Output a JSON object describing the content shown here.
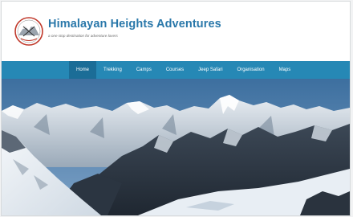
{
  "site": {
    "title": "Himalayan Heights Adventures",
    "tagline": "a one stop destination for adventure lovers"
  },
  "nav": {
    "items": [
      {
        "label": "Home",
        "active": true
      },
      {
        "label": "Trekking",
        "active": false
      },
      {
        "label": "Camps",
        "active": false
      },
      {
        "label": "Courses",
        "active": false
      },
      {
        "label": "Jeep Safari",
        "active": false
      },
      {
        "label": "Organisation",
        "active": false
      },
      {
        "label": "Maps",
        "active": false
      }
    ]
  },
  "icons": {
    "logo": "mountain-compass-logo-icon"
  },
  "colors": {
    "brand": "#2a78aa",
    "navbar": "#2688b5",
    "nav_active": "#1b6d97"
  }
}
